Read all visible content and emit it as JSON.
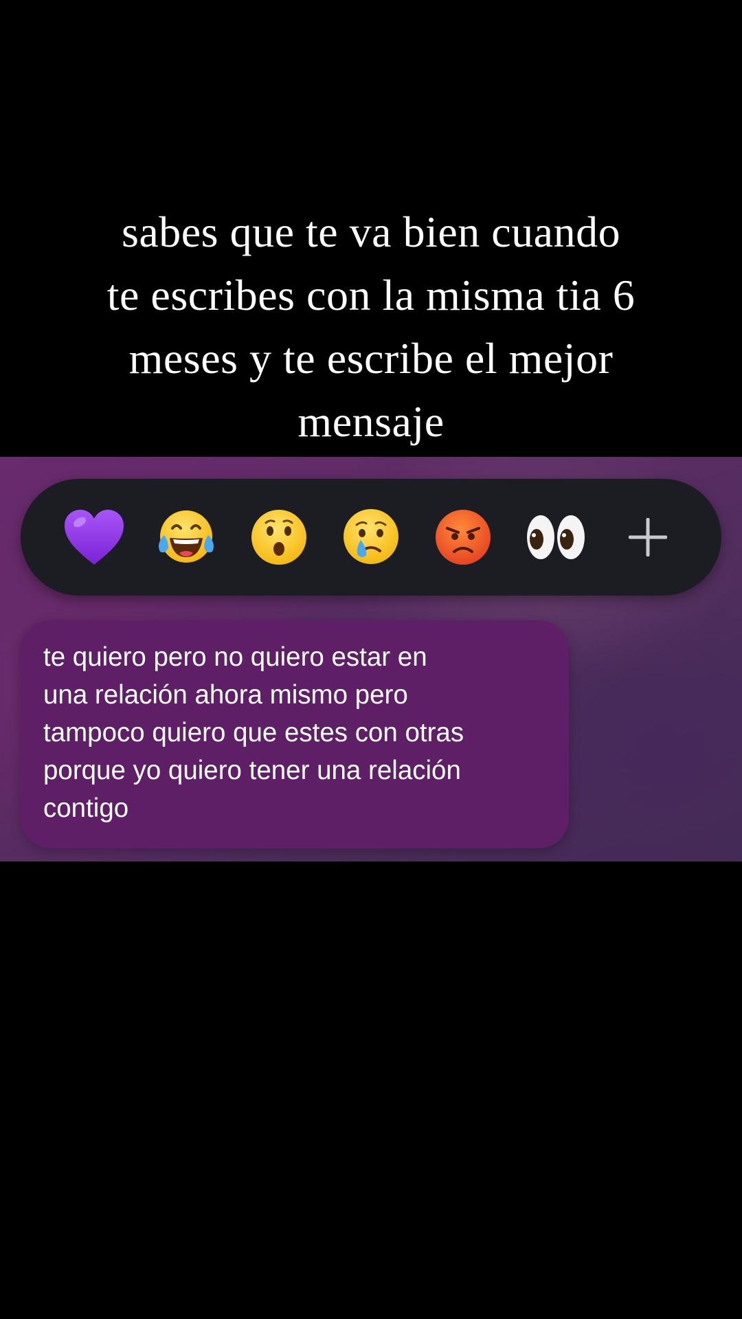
{
  "caption": {
    "lines": [
      "sabes que te va bien cuando",
      "te escribes con la misma tia 6",
      "meses y te escribe el mejor",
      "mensaje"
    ]
  },
  "reaction_bar": {
    "reactions": [
      {
        "name": "purple-heart",
        "glyph": "💜"
      },
      {
        "name": "face-with-tears-of-joy",
        "glyph": "😂"
      },
      {
        "name": "face-with-open-mouth",
        "glyph": "😮"
      },
      {
        "name": "crying-face",
        "glyph": "😢"
      },
      {
        "name": "pouting-face",
        "glyph": "😡"
      },
      {
        "name": "eyes",
        "glyph": "👀"
      }
    ],
    "more_icon": "plus-icon"
  },
  "message": {
    "lines": [
      "te quiero pero no quiero estar en",
      "una relación ahora mismo pero",
      "tampoco quiero que estes con otras",
      "porque yo quiero tener una relación",
      "contigo"
    ]
  },
  "colors": {
    "bubble": "#5e1f66",
    "reaction_bar": "#1b1d22",
    "background": "#000000"
  }
}
